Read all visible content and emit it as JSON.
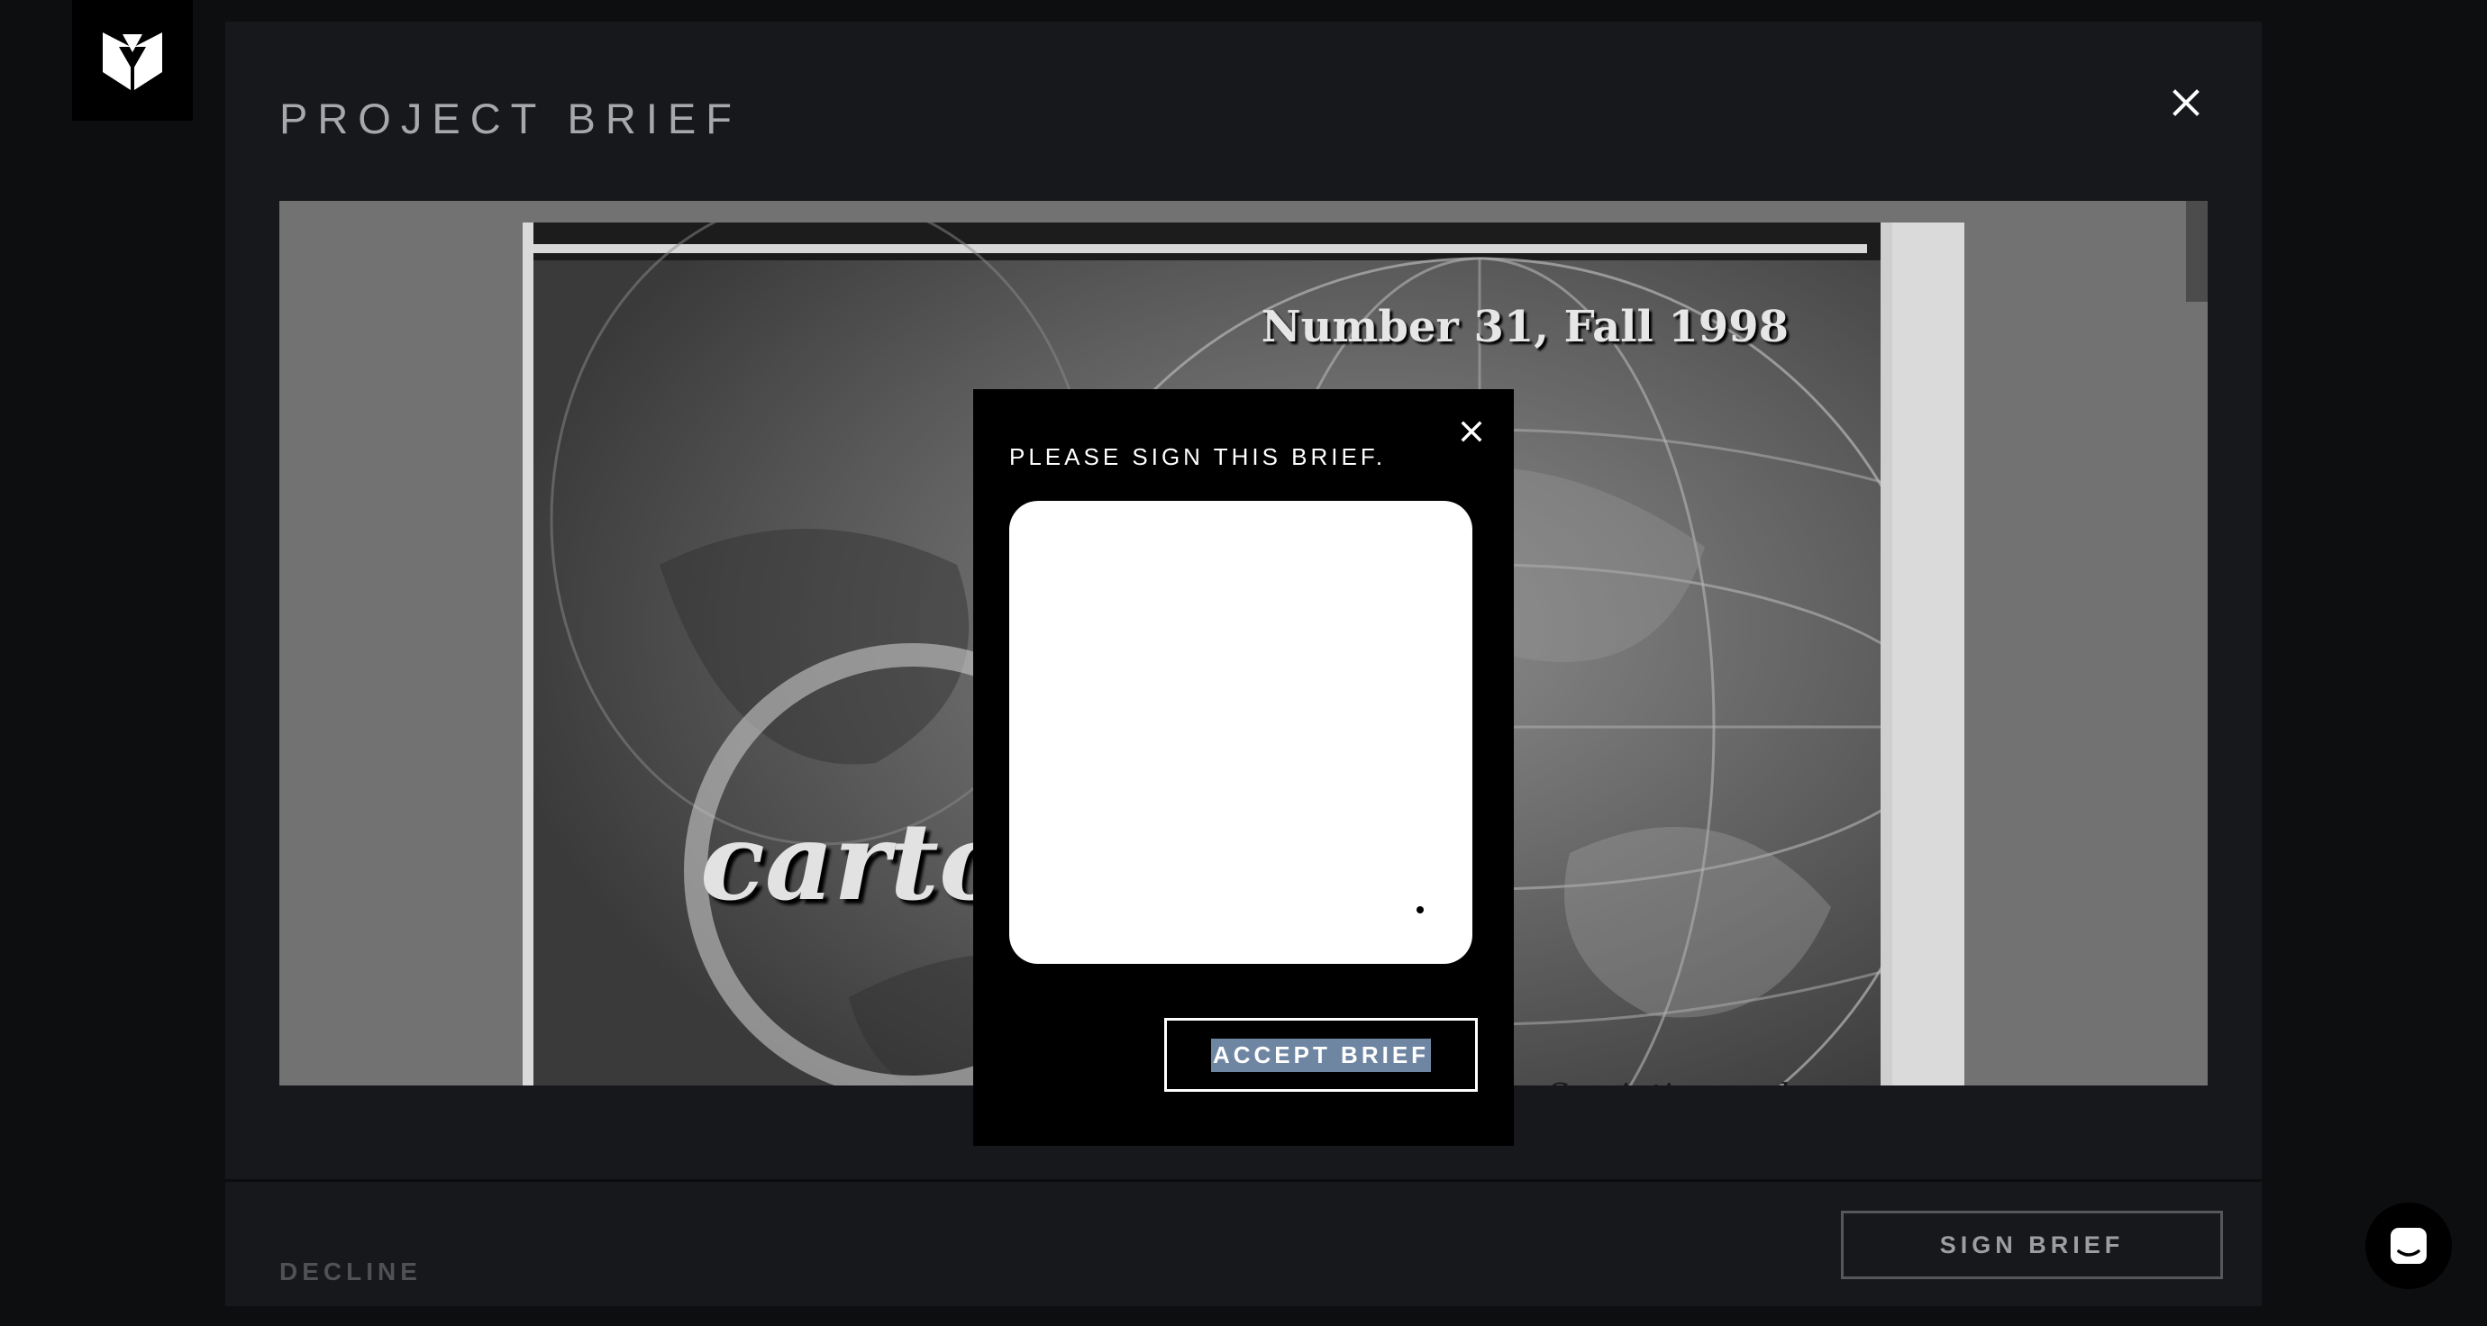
{
  "panel": {
    "title": "PROJECT BRIEF",
    "decline_label": "DECLINE",
    "sign_label": "SIGN BRIEF"
  },
  "document": {
    "issue": "Number 31, Fall 1998",
    "cover_title": "cartogr                    ives",
    "cover_subtitle": "alysis, Semiotics, and"
  },
  "modal": {
    "title": "PLEASE SIGN THIS BRIEF.",
    "accept_label": "ACCEPT BRIEF"
  },
  "icons": {
    "logo": "brand-logo-icon",
    "close": "close-icon",
    "chat": "chat-icon"
  },
  "colors": {
    "background": "#0d0e10",
    "panel": "#17181b",
    "modal": "#000000",
    "selection": "#6f86a3"
  }
}
